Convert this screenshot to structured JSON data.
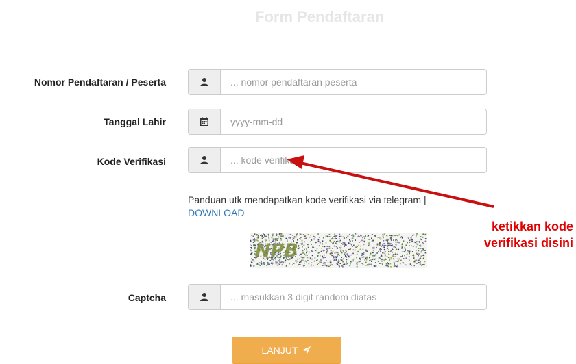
{
  "form": {
    "title": "Form Pendaftaran",
    "fields": [
      {
        "label": "Nomor Pendaftaran / Peserta",
        "placeholder": "... nomor pendaftaran peserta",
        "icon": "user-icon"
      },
      {
        "label": "Tanggal Lahir",
        "placeholder": "yyyy-mm-dd",
        "icon": "calendar-icon"
      },
      {
        "label": "Kode Verifikasi",
        "placeholder": "... kode verifikasi",
        "icon": "user-icon"
      },
      {
        "label": "Captcha",
        "placeholder": "... masukkan 3 digit random diatas",
        "icon": "user-icon"
      }
    ],
    "guide_text": "Panduan utk mendapatkan kode verifikasi via telegram |",
    "guide_link": "DOWNLOAD",
    "captcha_text": "NPB",
    "submit_label": "LANJUT"
  },
  "annotation": {
    "line1": "ketikkan kode",
    "line2": "verifikasi disini",
    "color": "#e00000"
  },
  "colors": {
    "button": "#f0ad4e",
    "link": "#337ab7",
    "title": "#e6e6e6"
  }
}
